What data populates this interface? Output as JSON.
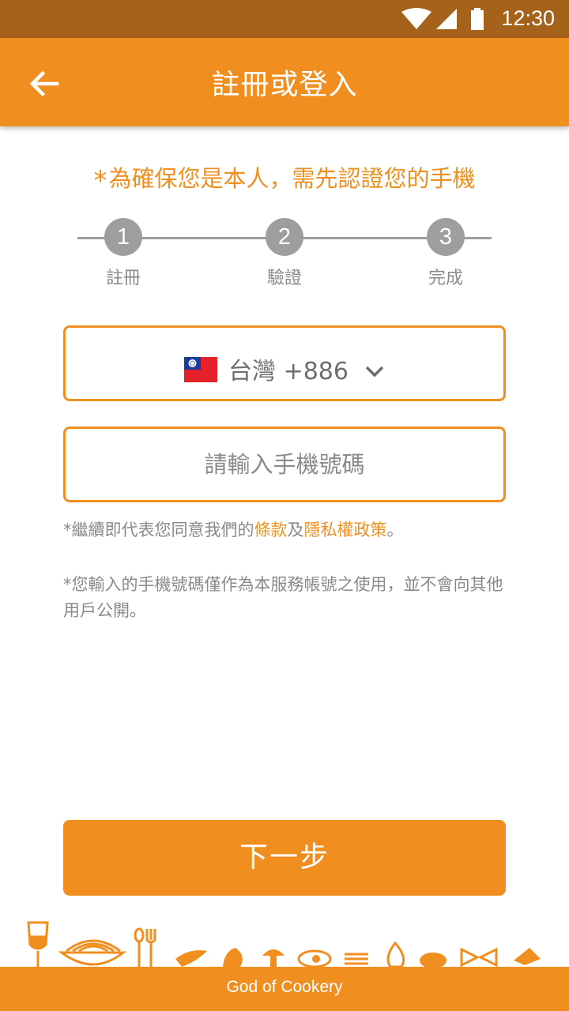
{
  "status_bar": {
    "time": "12:30",
    "icons": [
      "wifi-icon",
      "signal-icon",
      "battery-icon"
    ]
  },
  "app_bar": {
    "title": "註冊或登入",
    "back_icon": "arrow-left-icon"
  },
  "notice": {
    "star": "*",
    "text": "為確保您是本人，需先認證您的手機"
  },
  "steps": [
    {
      "number": "1",
      "label": "註冊"
    },
    {
      "number": "2",
      "label": "驗證"
    },
    {
      "number": "3",
      "label": "完成"
    }
  ],
  "country": {
    "name": "台灣",
    "code": "+886",
    "flag": "taiwan-flag-icon"
  },
  "phone": {
    "placeholder": "請輸入手機號碼",
    "value": ""
  },
  "terms": {
    "prefix": "*繼續即代表您同意我們的",
    "terms_link": "條款",
    "joiner": "及",
    "privacy_link": "隱私權政策",
    "suffix": "。"
  },
  "privacy_note": "*您輸入的手機號碼僅作為本服務帳號之使用，並不會向其他用戶公開。",
  "next_button": "下一步",
  "footer": "God of Cookery",
  "colors": {
    "accent": "#f08f1f",
    "status_bar": "#a5621b",
    "step_gray": "#9e9e9e",
    "text_gray": "#8a8a8a"
  }
}
